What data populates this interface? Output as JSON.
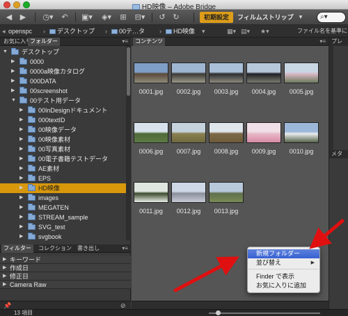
{
  "window": {
    "title": "HD映像 – Adobe Bridge"
  },
  "toolbar": {
    "workspace_active": "初期設定",
    "workspace_filmstrip": "フィルムストリップ",
    "icons": [
      "back-icon",
      "forward-icon",
      "recent-icon",
      "boomerang-icon",
      "camera-icon",
      "refine-icon",
      "open-icon",
      "output-icon",
      "rotate-left-icon",
      "rotate-right-icon"
    ]
  },
  "path": {
    "items": [
      "openspc",
      "デスクトップ",
      "00テ…タ",
      "HD映像"
    ],
    "right_label": "ファイル名を基準に"
  },
  "left_panel": {
    "tabs": [
      "お気に入り",
      "フォルダー"
    ],
    "folders": [
      {
        "label": "デスクトップ",
        "indent": 0,
        "expanded": true
      },
      {
        "label": "0000",
        "indent": 1
      },
      {
        "label": "0000a映像カタログ",
        "indent": 1
      },
      {
        "label": "000DATA",
        "indent": 1
      },
      {
        "label": "00screenshot",
        "indent": 1
      },
      {
        "label": "00テスト用データ",
        "indent": 1,
        "expanded": true
      },
      {
        "label": "00InDesignドキュメント",
        "indent": 2
      },
      {
        "label": "000textID",
        "indent": 2
      },
      {
        "label": "00映像データ",
        "indent": 2
      },
      {
        "label": "00映像素材",
        "indent": 2
      },
      {
        "label": "00写真素材",
        "indent": 2
      },
      {
        "label": "00電子書籍テストデータ",
        "indent": 2
      },
      {
        "label": "AE素材",
        "indent": 2
      },
      {
        "label": "EPS",
        "indent": 2
      },
      {
        "label": "HD映像",
        "indent": 2,
        "selected": true
      },
      {
        "label": "images",
        "indent": 2
      },
      {
        "label": "MEGATEN",
        "indent": 2
      },
      {
        "label": "STREAM_sample",
        "indent": 2
      },
      {
        "label": "SVG_test",
        "indent": 2
      },
      {
        "label": "svgbook",
        "indent": 2
      }
    ],
    "filter_tabs": [
      "フィルター",
      "コレクション",
      "書き出し"
    ],
    "filters": [
      "キーワード",
      "作成日",
      "修正日",
      "Camera Raw"
    ]
  },
  "content": {
    "tab": "コンテンツ",
    "files": [
      {
        "name": "0001.jpg",
        "colors": [
          "#7f9fc6",
          "#5b4a3a",
          "#8e8b7a"
        ]
      },
      {
        "name": "0002.jpg",
        "colors": [
          "#9fb6d2",
          "#3d3a36",
          "#9c9a8a"
        ]
      },
      {
        "name": "0003.jpg",
        "colors": [
          "#a9c0d8",
          "#2e2e30",
          "#8c8a7d"
        ]
      },
      {
        "name": "0004.jpg",
        "colors": [
          "#b6c7da",
          "#202025",
          "#7b7b72"
        ]
      },
      {
        "name": "0005.jpg",
        "colors": [
          "#c9d6e4",
          "#d8b9c4",
          "#6d7a5e"
        ]
      },
      {
        "name": "0006.jpg",
        "colors": [
          "#d7e2ec",
          "#4f6a3a",
          "#5d7a44"
        ]
      },
      {
        "name": "0007.jpg",
        "colors": [
          "#c6d3dc",
          "#8a7f52",
          "#6f6a3e"
        ]
      },
      {
        "name": "0008.jpg",
        "colors": [
          "#dfe7ec",
          "#7d6a48",
          "#6e5b3a"
        ]
      },
      {
        "name": "0009.jpg",
        "colors": [
          "#f0dfe6",
          "#e8b9c8",
          "#d78aa4"
        ]
      },
      {
        "name": "0010.jpg",
        "colors": [
          "#9cb7d8",
          "#e9ecef",
          "#55624a"
        ]
      },
      {
        "name": "0011.jpg",
        "colors": [
          "#dfe5df",
          "#3b4a2e",
          "#e9eee6"
        ]
      },
      {
        "name": "0012.jpg",
        "colors": [
          "#cfd8e6",
          "#8a8f9b",
          "#c6cbd6"
        ]
      },
      {
        "name": "0013.jpg",
        "colors": [
          "#b9c9dc",
          "#60704c",
          "#7a8a56"
        ]
      }
    ]
  },
  "right_panel": {
    "tab_top": "プレ",
    "tab_mid": "メタ"
  },
  "status": {
    "count": "13 項目"
  },
  "context_menu": {
    "items": [
      "新規フォルダー",
      "並び替え",
      "Finder で表示",
      "お気に入りに追加"
    ],
    "highlighted": "新規フォルダー"
  },
  "colors": {
    "accent": "#dd9d1a",
    "selection": "#d8980c",
    "menu_highlight": "#3660d2",
    "arrow": "#e01010"
  }
}
